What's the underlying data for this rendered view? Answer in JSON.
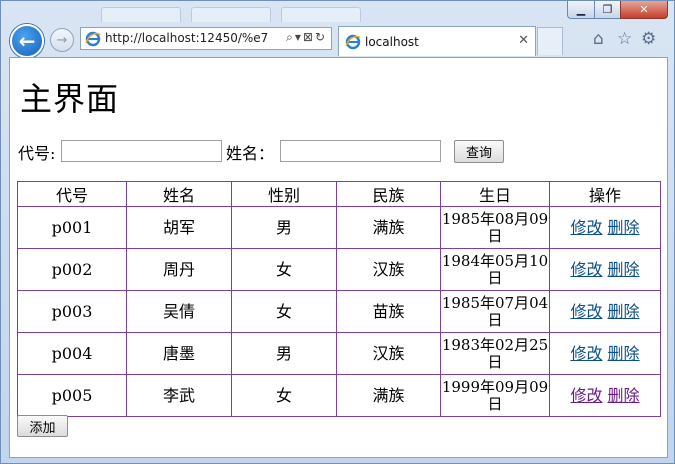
{
  "browser": {
    "address": "http://localhost:12450/%e7",
    "tab_title": "localhost",
    "back_icon": "back-arrow-icon",
    "forward_icon": "forward-arrow-icon"
  },
  "page": {
    "title": "主界面",
    "search": {
      "code_label": "代号:",
      "name_label": "姓名：",
      "code_value": "",
      "name_value": "",
      "query_button": "查询"
    },
    "table": {
      "headers": [
        "代号",
        "姓名",
        "性别",
        "民族",
        "生日",
        "操作"
      ],
      "rows": [
        {
          "code": "p001",
          "name": "胡军",
          "sex": "男",
          "nation": "满族",
          "birthday": "1985年08月09日"
        },
        {
          "code": "p002",
          "name": "周丹",
          "sex": "女",
          "nation": "汉族",
          "birthday": "1984年05月10日"
        },
        {
          "code": "p003",
          "name": "吴倩",
          "sex": "女",
          "nation": "苗族",
          "birthday": "1985年07月04日"
        },
        {
          "code": "p004",
          "name": "唐墨",
          "sex": "男",
          "nation": "汉族",
          "birthday": "1983年02月25日"
        },
        {
          "code": "p005",
          "name": "李武",
          "sex": "女",
          "nation": "满族",
          "birthday": "1999年09月09日"
        }
      ],
      "edit_label": "修改",
      "delete_label": "删除"
    },
    "add_button": "添加"
  }
}
